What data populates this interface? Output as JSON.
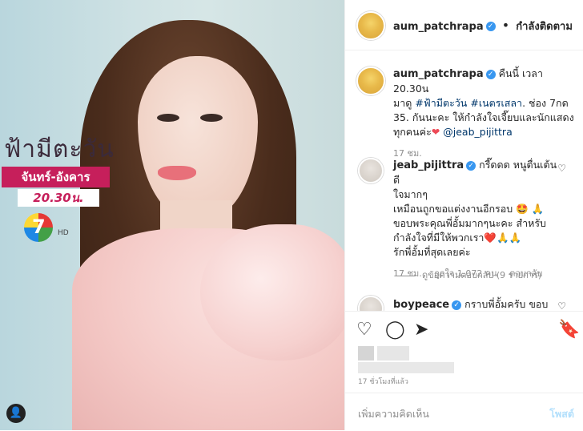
{
  "post_image": {
    "show_title": "ฟ้ามีตะวัน",
    "days": "จันทร์-อังคาร",
    "time": "20.30น.",
    "channel": "7",
    "channel_hd": "HD"
  },
  "header": {
    "username": "aum_patchrapa",
    "separator": "•",
    "follow_label": "กำลังติดตาม"
  },
  "caption": {
    "username": "aum_patchrapa",
    "text_1": "คืนนี้ เวลา 20.30น",
    "text_2": "มาดู",
    "hashtag_1": "#ฟ้ามีตะวัน",
    "hashtag_2": "#เนตรเสลา",
    "text_3": ". ช่อง 7กด",
    "text_4": "35. กันนะคะ ให้กำลังใจเจี๊ยบและนักแสดง",
    "text_5": "ทุกคนค่ะ",
    "mention": "@jeab_pijittra",
    "time": "17 ชม."
  },
  "comments": [
    {
      "username": "jeab_pijittra",
      "line_1": "กรี๊ดดด หนูตื่นเต้นดี",
      "line_2": "ใจมากๆ",
      "line_3": "เหมือนถูกขอแต่งงานอีกรอบ 🤩 🙏",
      "line_4": "ขอบพระคุณพี่อั้มมากๆนะคะ สำหรับ",
      "line_5": "กำลังใจที่มีให้พวกเรา❤️🙏🙏",
      "line_6": "รักพี่อั้มที่สุดเลยค่ะ",
      "time": "17 ชม.",
      "likes": "ถูกใจ 1,072 คน",
      "reply": "ตอบกลับ",
      "view_replies": "ดูข้อความตอบกลับ (9 รายการ)"
    },
    {
      "username": "boypeace",
      "text": "กราบพี่อั้มครับ ขอบ"
    }
  ],
  "post_time": "17 ชั่วโมงที่แล้ว",
  "add_comment_placeholder": "เพิ่มความคิดเห็น",
  "post_button": "โพสต์",
  "icons": {
    "heart": "heart-icon",
    "comment": "comment-icon",
    "share": "share-icon",
    "save": "bookmark-icon"
  },
  "colors": {
    "link": "#00376b",
    "verified": "#3897f0",
    "post_button": "#b2dffc",
    "banner": "#c61f5b"
  }
}
